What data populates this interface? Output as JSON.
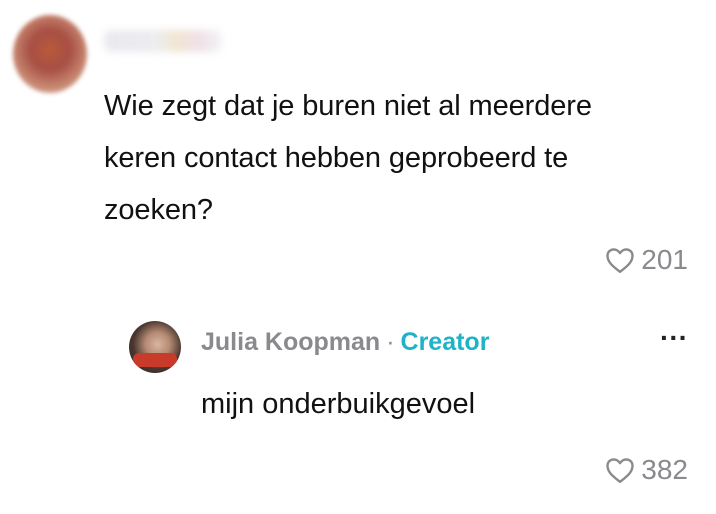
{
  "comment": {
    "text": "Wie zegt dat je buren niet al meerdere keren contact hebben geprobeerd te zoeken?",
    "likes": "201"
  },
  "reply": {
    "author": "Julia Koopman",
    "separator": "·",
    "badge": "Creator",
    "text": "mijn onderbuikgevoel",
    "likes": "382",
    "more_label": "···"
  },
  "colors": {
    "text": "#111111",
    "muted": "#8a8a8e",
    "creator_badge": "#1fb3c7"
  },
  "icons": {
    "like": "heart-outline-icon",
    "more": "more-horizontal-icon"
  }
}
